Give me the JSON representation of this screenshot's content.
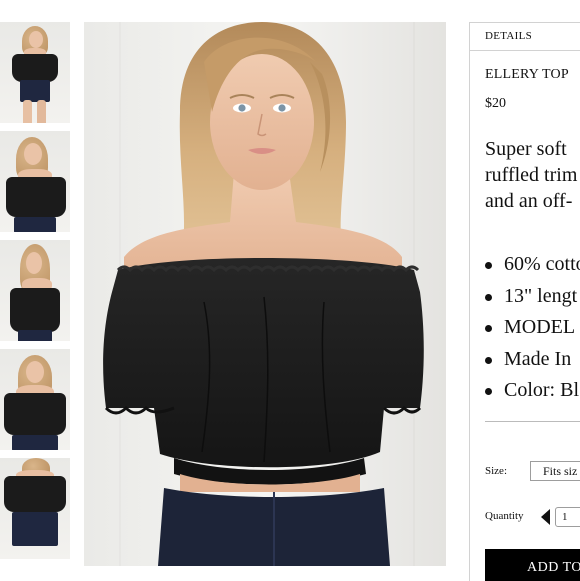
{
  "thumbnails": [
    {
      "label": "thumbnail-1"
    },
    {
      "label": "thumbnail-2"
    },
    {
      "label": "thumbnail-3"
    },
    {
      "label": "thumbnail-4"
    },
    {
      "label": "thumbnail-5"
    }
  ],
  "details": {
    "tab_label": "DETAILS",
    "product_name": "ELLERY TOP",
    "price": "$20",
    "description_lines": [
      "Super soft",
      "ruffled trim",
      "and an off-"
    ],
    "bullets": [
      "60% cotto",
      "13\" lengt",
      "MODEL",
      "Made In",
      "Color: Bl"
    ],
    "size_label": "Size:",
    "size_value": "Fits siz",
    "quantity_label": "Quantity",
    "quantity_value": "1",
    "add_button": "ADD TO"
  },
  "colors": {
    "top_black": "#1b1b1b",
    "button_black": "#000000",
    "border_gray": "#d2d2d2"
  }
}
